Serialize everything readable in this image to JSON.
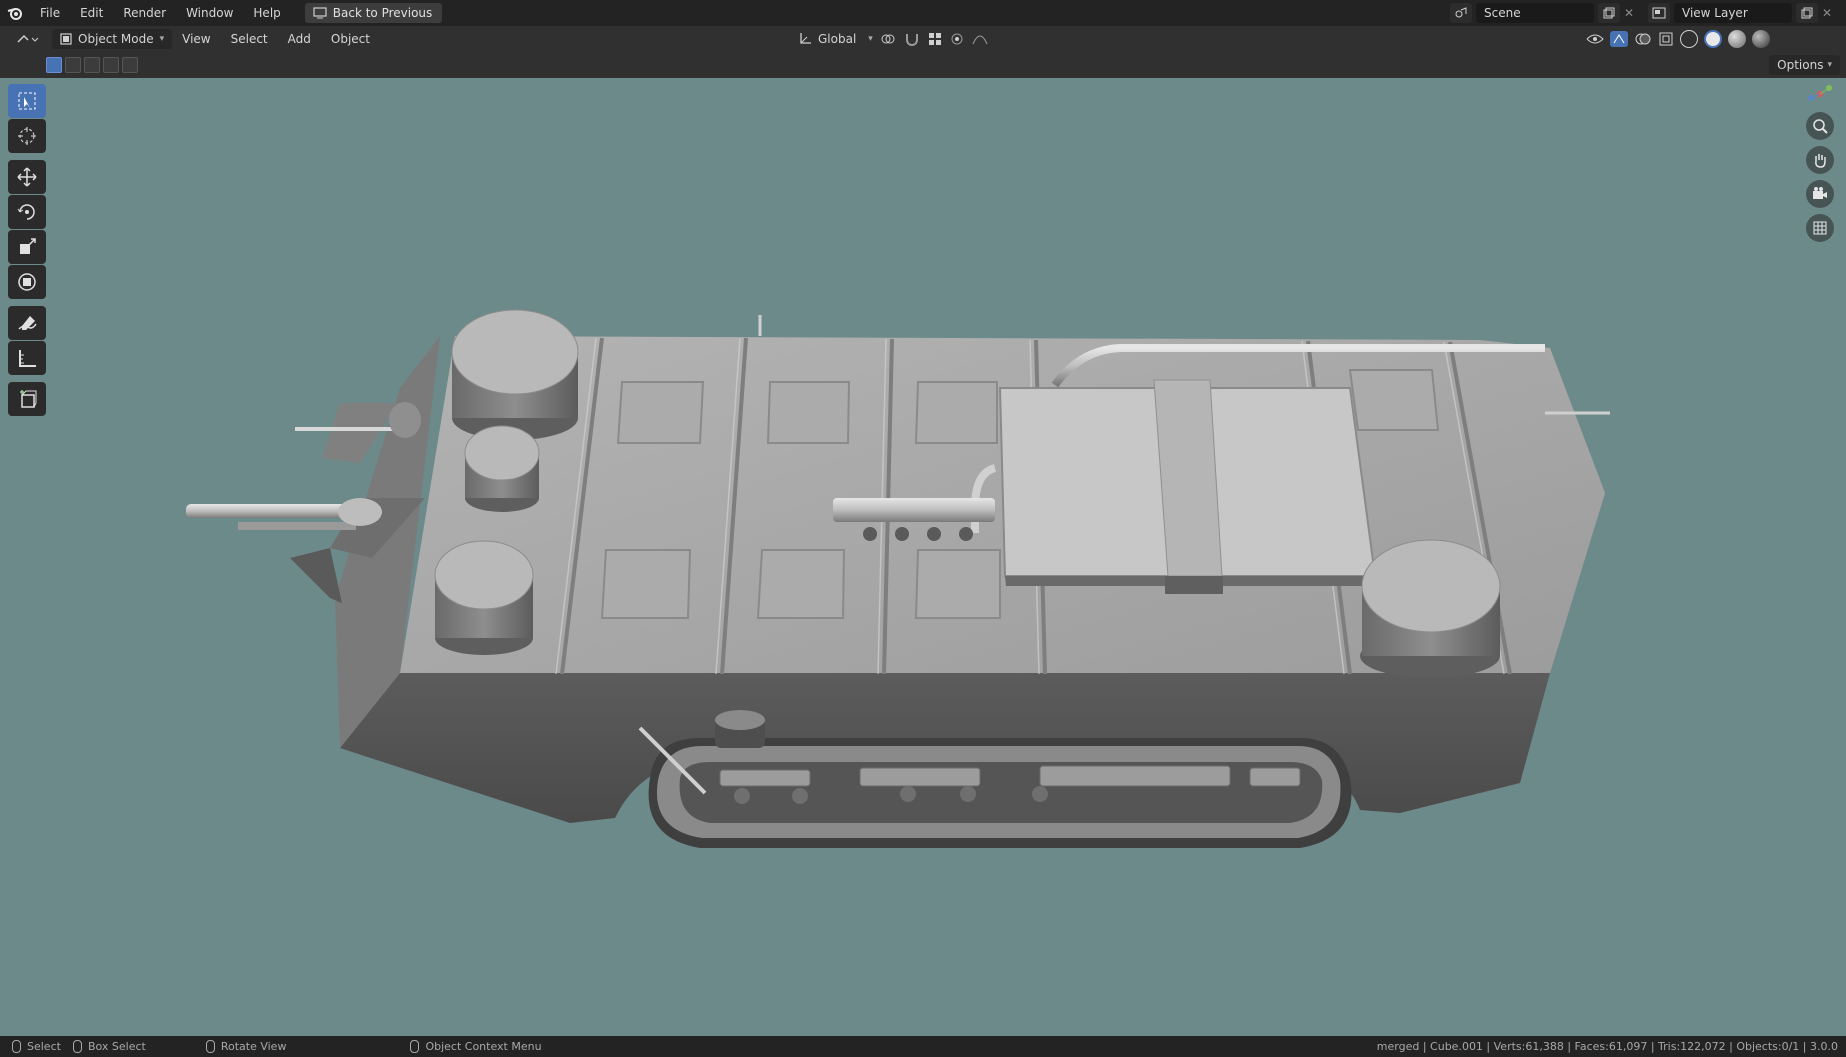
{
  "topbar": {
    "menus": [
      "File",
      "Edit",
      "Render",
      "Window",
      "Help"
    ],
    "back_button": "Back to Previous",
    "scene_name": "Scene",
    "view_layer_name": "View Layer"
  },
  "header": {
    "mode": "Object Mode",
    "menus": [
      "View",
      "Select",
      "Add",
      "Object"
    ],
    "transform_orientation": "Global"
  },
  "toolrow": {
    "options_label": "Options"
  },
  "toolbar": {
    "tools": [
      "select-box-icon",
      "cursor-icon",
      "move-icon",
      "rotate-icon",
      "scale-icon",
      "transform-icon",
      "annotate-icon",
      "measure-icon",
      "add-cube-icon"
    ]
  },
  "statusbar": {
    "hints": [
      {
        "label": "Select"
      },
      {
        "label": "Box Select"
      },
      {
        "label": "Rotate View"
      },
      {
        "label": "Object Context Menu"
      }
    ],
    "stats": "merged | Cube.001 | Verts:61,388 | Faces:61,097 | Tris:122,072 | Objects:0/1 | 3.0.0"
  },
  "colors": {
    "viewport_bg": "#6d8a8a",
    "accent": "#4772b3",
    "model_light": "#a9a9a9",
    "model_dark": "#5b5b5b"
  }
}
